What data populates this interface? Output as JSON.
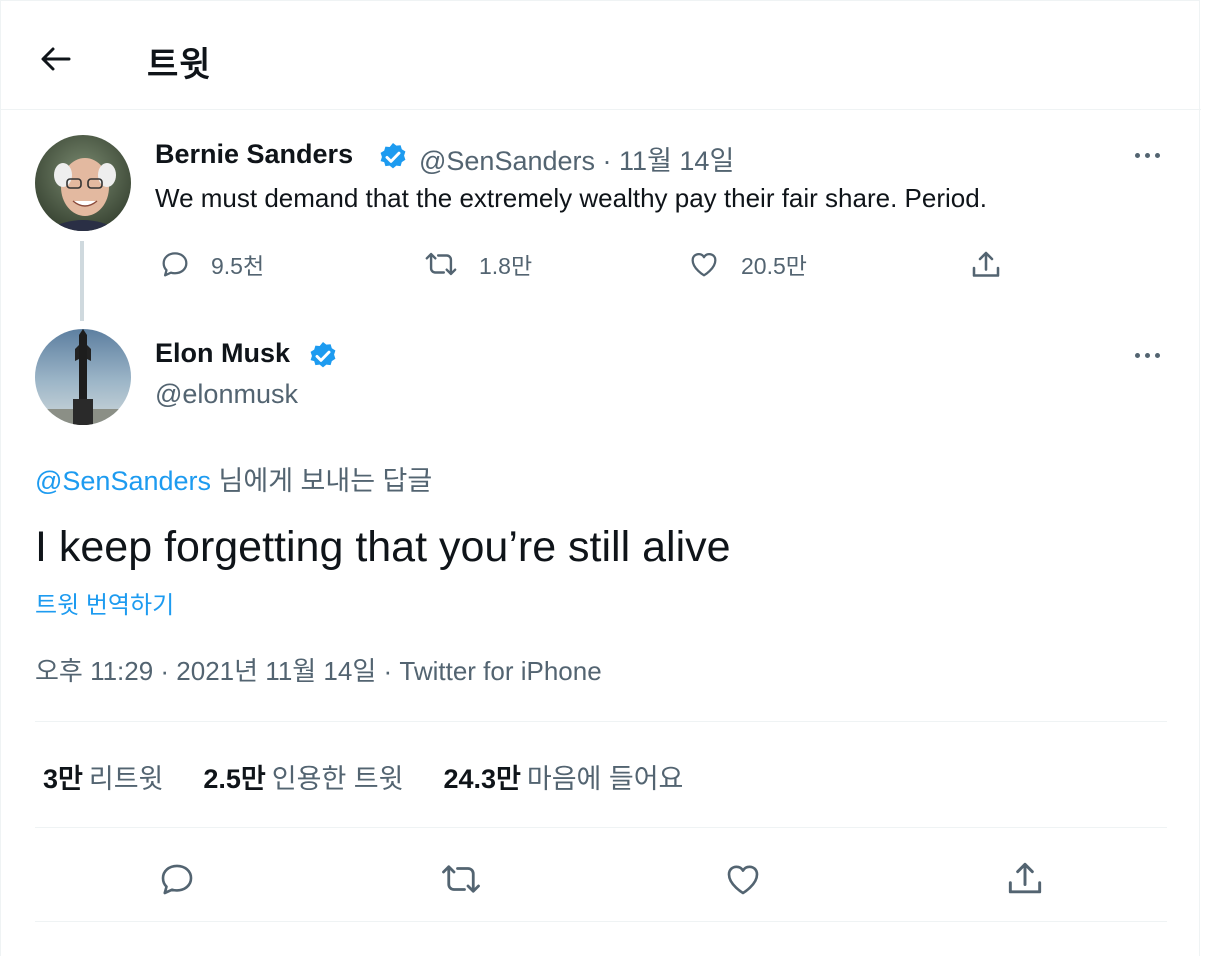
{
  "header": {
    "title": "트윗"
  },
  "parent_tweet": {
    "name": "Bernie Sanders",
    "handle": "@SenSanders",
    "separator": "·",
    "date": "11월 14일",
    "text": "We must demand that the extremely wealthy pay their fair share. Period.",
    "reply_count": "9.5천",
    "retweet_count": "1.8만",
    "like_count": "20.5만"
  },
  "main_tweet": {
    "name": "Elon Musk",
    "handle": "@elonmusk",
    "reply_to_mention": "@SenSanders",
    "reply_to_suffix": " 님에게 보내는 답글",
    "text": "I keep forgetting that you’re still alive",
    "translate_label": "트윗 번역하기",
    "meta": "오후 11:29 · 2021년 11월 14일 · Twitter for iPhone",
    "stats": [
      {
        "value": "3만",
        "label": "리트윗"
      },
      {
        "value": "2.5만",
        "label": "인용한 트윗"
      },
      {
        "value": "24.3만",
        "label": "마음에 들어요"
      }
    ]
  },
  "colors": {
    "accent": "#1d9bf0",
    "muted": "#536471",
    "text": "#0f1419",
    "border": "#eff3f4"
  },
  "icons": [
    "back-arrow-icon",
    "verified-badge-icon",
    "more-icon",
    "reply-icon",
    "retweet-icon",
    "like-icon",
    "share-icon"
  ]
}
